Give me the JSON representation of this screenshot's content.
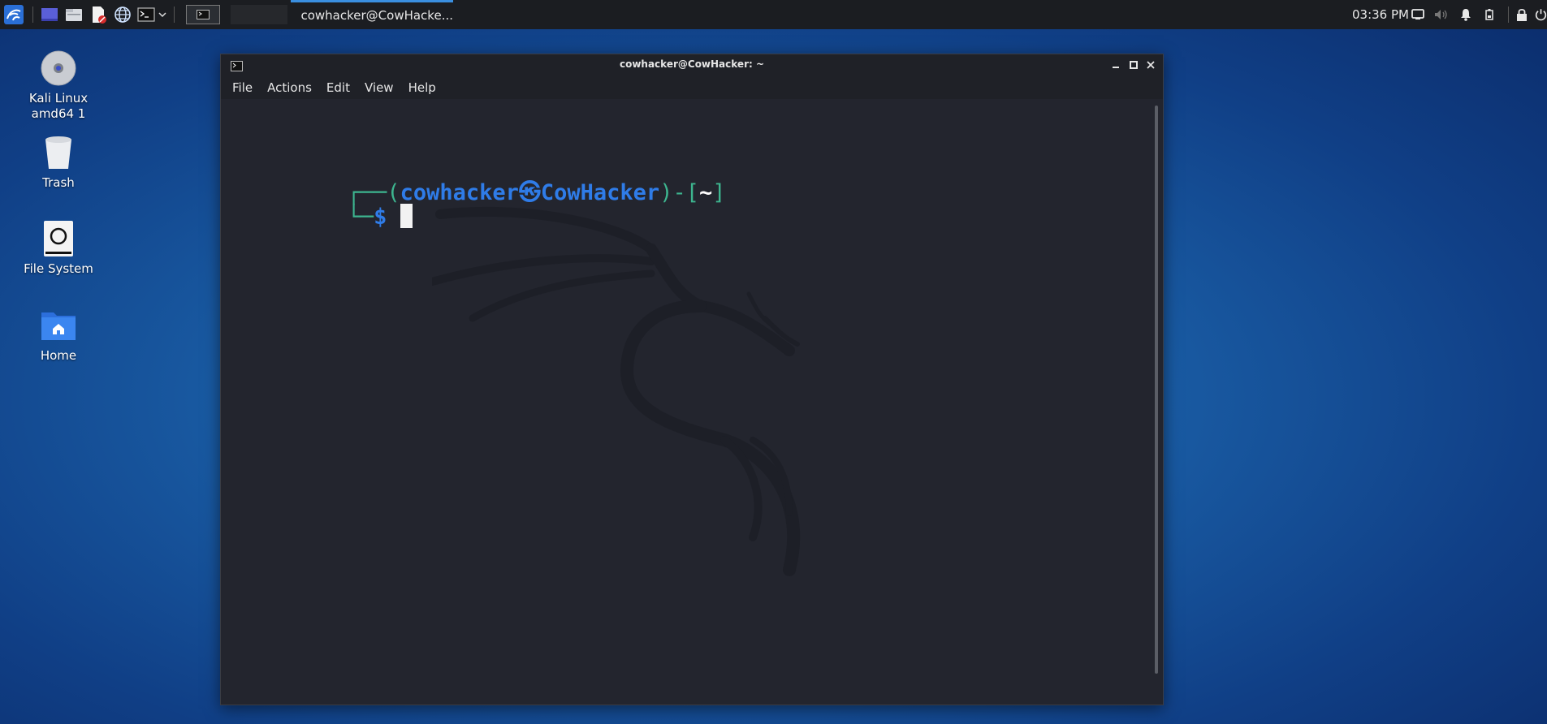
{
  "panel": {
    "task_title": "cowhacker@CowHacke...",
    "clock": "03:36 PM",
    "icons": [
      "kali-menu-icon",
      "show-desktop-icon",
      "file-manager-icon",
      "text-editor-icon",
      "web-browser-icon",
      "terminal-icon",
      "dropdown-icon",
      "workspace-1",
      "workspace-2",
      "display-icon",
      "volume-icon",
      "notifications-icon",
      "battery-icon",
      "lock-icon",
      "power-icon"
    ]
  },
  "desktop": {
    "items": [
      {
        "label": "Kali Linux amd64 1",
        "icon": "optical-disc-icon"
      },
      {
        "label": "Trash",
        "icon": "trash-icon"
      },
      {
        "label": "File System",
        "icon": "drive-icon"
      },
      {
        "label": "Home",
        "icon": "home-folder-icon"
      }
    ]
  },
  "window": {
    "title": "cowhacker@CowHacker: ~",
    "menu": [
      "File",
      "Actions",
      "Edit",
      "View",
      "Help"
    ]
  },
  "terminal": {
    "user": "cowhacker",
    "at_symbol": "㉿",
    "host": "CowHacker",
    "dir": "~",
    "symbol": "$"
  },
  "colors": {
    "prompt_frame": "#3db58f",
    "user_host": "#2f7ce8",
    "dir": "#ffffff",
    "background": "#23252e",
    "panel": "#1b1d21"
  }
}
